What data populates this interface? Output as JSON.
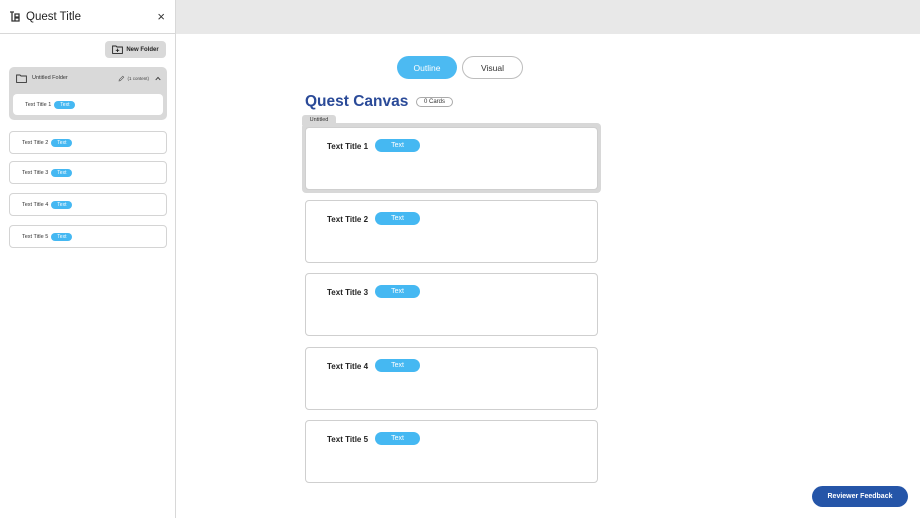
{
  "sidebar": {
    "title": "Quest Title",
    "close_label": "×",
    "new_folder_label": "New Folder",
    "folder": {
      "name": "Untitled Folder",
      "count": "(1 content)",
      "items": [
        {
          "label": "Text Title 1",
          "badge": "Text"
        }
      ]
    },
    "items": [
      {
        "label": "Text Title 2",
        "badge": "Text"
      },
      {
        "label": "Text Title 3",
        "badge": "Text"
      },
      {
        "label": "Text Title 4",
        "badge": "Text"
      },
      {
        "label": "Text Title 5",
        "badge": "Text"
      }
    ]
  },
  "toggle": {
    "outline": "Outline",
    "visual": "Visual",
    "active": "outline"
  },
  "canvas": {
    "title": "Quest Canvas",
    "cards_count": "0 Cards",
    "group_label": "Untitled",
    "cards": [
      {
        "title": "Text Title 1",
        "badge": "Text"
      },
      {
        "title": "Text Title 2",
        "badge": "Text"
      },
      {
        "title": "Text Title 3",
        "badge": "Text"
      },
      {
        "title": "Text Title 4",
        "badge": "Text"
      },
      {
        "title": "Text Title 5",
        "badge": "Text"
      }
    ]
  },
  "feedback_label": "Reviewer Feedback",
  "colors": {
    "accent": "#45b8f2",
    "primary": "#2555a8",
    "title": "#2a4a98"
  },
  "icons": [
    "logo-icon",
    "close-icon",
    "folder-plus-icon",
    "folder-icon",
    "pencil-icon",
    "chevron-up-icon"
  ]
}
